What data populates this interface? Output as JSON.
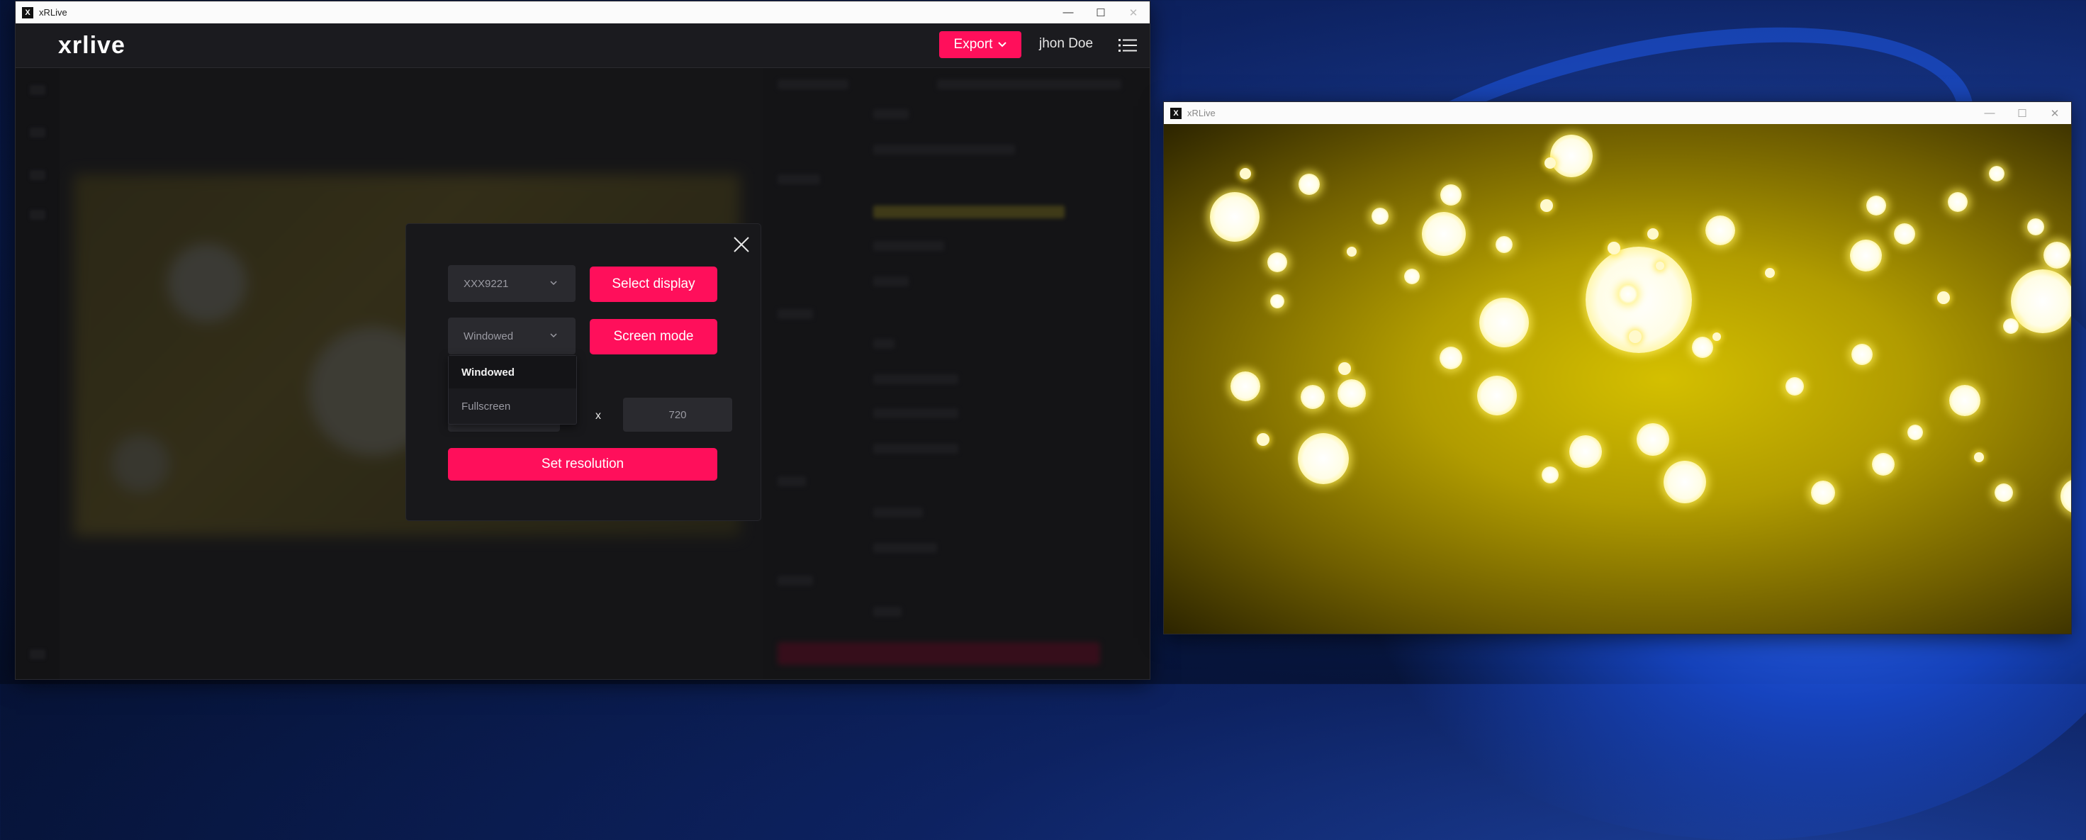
{
  "main_window": {
    "title": "xRLive",
    "app_icon": "X",
    "controls": {
      "minimize": "—",
      "maximize": "☐",
      "close": "✕"
    }
  },
  "header": {
    "logo": "xrlive",
    "export_label": "Export",
    "user_name": "jhon Doe"
  },
  "modal": {
    "display_select_value": "XXX9221",
    "select_display_label": "Select display",
    "screen_mode_value": "Windowed",
    "screen_mode_label": "Screen mode",
    "screen_mode_options": [
      "Windowed",
      "Fullscreen"
    ],
    "resolution_separator": "x",
    "resolution_height": "720",
    "set_resolution_label": "Set resolution"
  },
  "preview_window": {
    "title": "xRLive",
    "app_icon": "X"
  },
  "colors": {
    "accent": "#ff0f5b",
    "app_background": "#1e1e22",
    "modal_background": "#18181b"
  }
}
